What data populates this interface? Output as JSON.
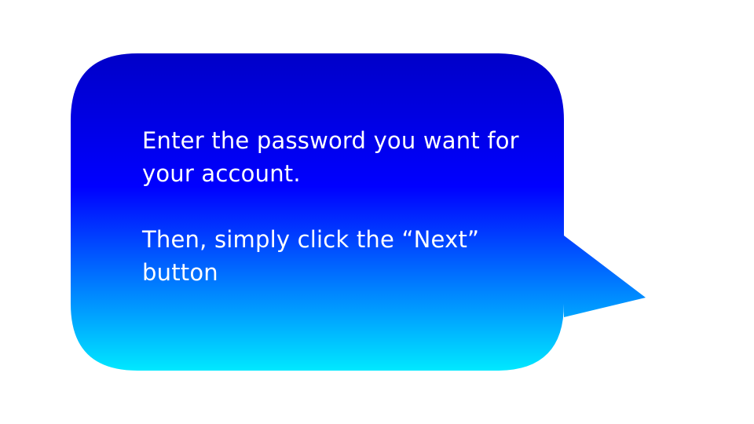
{
  "tooltip": {
    "line1": "Enter the password you want for your account.",
    "line2": "Then, simply click the “Next” button"
  },
  "colors": {
    "gradient_top": "#0000c8",
    "gradient_mid": "#0000ff",
    "gradient_bottom": "#00e8ff",
    "text": "#ffffff"
  }
}
